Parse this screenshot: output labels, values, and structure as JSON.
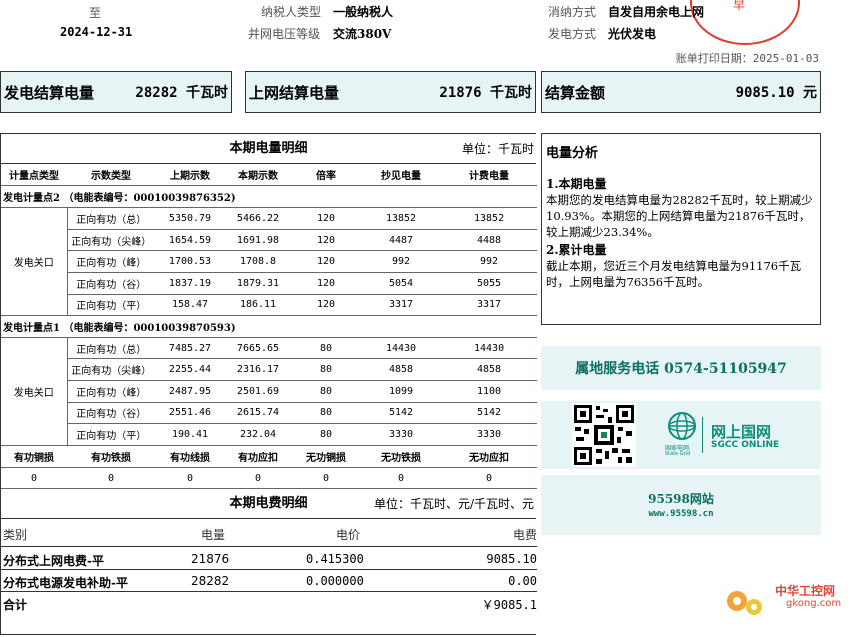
{
  "header": {
    "to_label": "至",
    "end_date": "2024-12-31",
    "taxpayer_type_label": "纳税人类型",
    "taxpayer_type": "一般纳税人",
    "voltage_label": "并网电压等级",
    "voltage": "交流380V",
    "consumption_label": "消纳方式",
    "consumption": "自发自用余电上网",
    "generation_label": "发电方式",
    "generation": "光伏发电",
    "print_date": "账单打印日期：2025-01-03",
    "stamp_text": "早"
  },
  "summary": [
    {
      "label": "发电结算电量",
      "value": "28282 千瓦时"
    },
    {
      "label": "上网结算电量",
      "value": "21876 千瓦时"
    },
    {
      "label": "结算金额",
      "value": "9085.10 元"
    }
  ],
  "detail": {
    "title": "本期电量明细",
    "unit": "单位：千瓦时",
    "headers": [
      "计量点类型",
      "示数类型",
      "上期示数",
      "本期示数",
      "倍率",
      "抄见电量",
      "计费电量"
    ],
    "points": [
      {
        "title": "发电计量点2 （电能表编号：00010039876352)",
        "type": "发电关口",
        "rows": [
          [
            "正向有功（总）",
            "5350.79",
            "5466.22",
            "120",
            "13852",
            "13852"
          ],
          [
            "正向有功（尖峰）",
            "1654.59",
            "1691.98",
            "120",
            "4487",
            "4488"
          ],
          [
            "正向有功（峰）",
            "1700.53",
            "1708.8",
            "120",
            "992",
            "992"
          ],
          [
            "正向有功（谷）",
            "1837.19",
            "1879.31",
            "120",
            "5054",
            "5055"
          ],
          [
            "正向有功（平）",
            "158.47",
            "186.11",
            "120",
            "3317",
            "3317"
          ]
        ]
      },
      {
        "title": "发电计量点1 （电能表编号：00010039870593)",
        "type": "发电关口",
        "rows": [
          [
            "正向有功（总）",
            "7485.27",
            "7665.65",
            "80",
            "14430",
            "14430"
          ],
          [
            "正向有功（尖峰）",
            "2255.44",
            "2316.17",
            "80",
            "4858",
            "4858"
          ],
          [
            "正向有功（峰）",
            "2487.95",
            "2501.69",
            "80",
            "1099",
            "1100"
          ],
          [
            "正向有功（谷）",
            "2551.46",
            "2615.74",
            "80",
            "5142",
            "5142"
          ],
          [
            "正向有功（平）",
            "190.41",
            "232.04",
            "80",
            "3330",
            "3330"
          ]
        ]
      }
    ],
    "loss_headers": [
      "有功铜损",
      "有功铁损",
      "有功线损",
      "有功应扣",
      "无功铜损",
      "无功铁损",
      "无功应扣"
    ],
    "loss_values": [
      "0",
      "0",
      "0",
      "0",
      "0",
      "0",
      "0"
    ]
  },
  "fee": {
    "title": "本期电费明细",
    "unit": "单位：千瓦时、元/千瓦时、元",
    "headers": [
      "类别",
      "电量",
      "电价",
      "电费"
    ],
    "rows": [
      [
        "分布式上网电费-平",
        "21876",
        "0.415300",
        "9085.10"
      ],
      [
        "分布式电源发电补助-平",
        "28282",
        "0.000000",
        "0.00"
      ]
    ],
    "total_label": "合计",
    "total": "￥9085.1"
  },
  "analysis": {
    "title": "电量分析",
    "s1_title": "1.本期电量",
    "s1_text": "本期您的发电结算电量为28282千瓦时，较上期减少10.93%。本期您的上网结算电量为21876千瓦时，较上期减少23.34%。",
    "s2_title": "2.累计电量",
    "s2_text": "截止本期，您近三个月发电结算电量为91176千瓦时，上网电量为76356千瓦时。"
  },
  "service": {
    "phone": "属地服务电话 0574-51105947",
    "sgcc_cn": "网上国网",
    "sgcc_en": "SGCC ONLINE",
    "sgcc_logo_cn": "国家电网",
    "sgcc_logo_en": "State Grid",
    "site_name": "95598网站",
    "site_url": "www.95598.cn"
  },
  "watermark": {
    "cn": "中华工控网",
    "en": "gkong.com"
  },
  "colors": {
    "tile_bg": "#e6f4f6",
    "sgcc_green": "#0c8e7a",
    "phone_green": "#0b6e5f",
    "stamp_red": "#e23a2d"
  }
}
